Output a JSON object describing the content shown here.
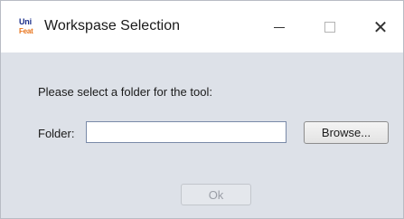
{
  "window": {
    "title": "Workspase Selection",
    "icon": {
      "name": "unifeat-logo-icon",
      "top_text": "Uni",
      "bottom_text": "Feat"
    },
    "controls": {
      "minimize_icon": "minimize-icon",
      "maximize_icon": "maximize-icon",
      "close_icon": "close-icon",
      "close_glyph": "✕"
    }
  },
  "dialog": {
    "prompt": "Please select a folder for the tool:",
    "folder_label": "Folder:",
    "folder_value": "",
    "browse_label": "Browse...",
    "ok_label": "Ok",
    "ok_enabled": false
  },
  "colors": {
    "dialog_background": "#dde1e8",
    "titlebar_background": "#ffffff",
    "input_border": "#7a8aa8",
    "logo_blue": "#1a2e8a",
    "logo_orange": "#e8731a"
  }
}
